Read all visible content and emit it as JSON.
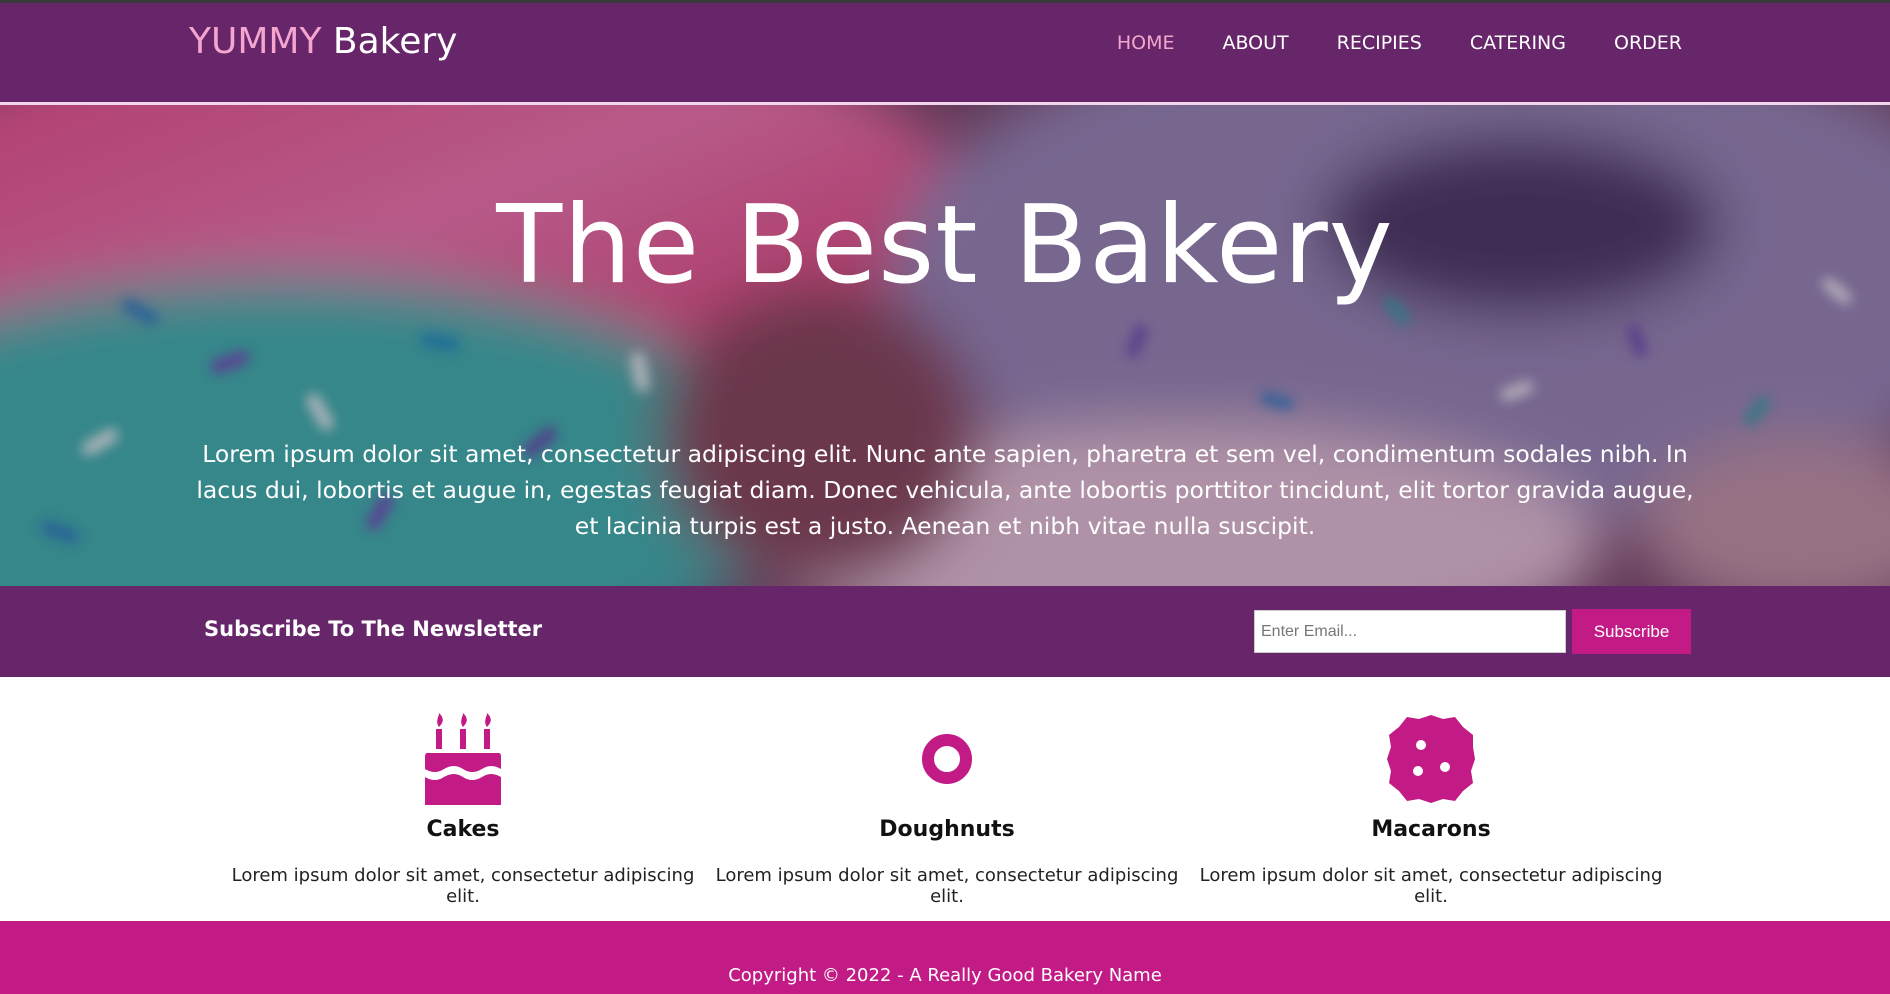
{
  "brand": {
    "accent": "YUMMY",
    "name": "Bakery"
  },
  "nav": {
    "items": [
      {
        "label": "HOME",
        "active": true
      },
      {
        "label": "ABOUT"
      },
      {
        "label": "RECIPIES"
      },
      {
        "label": "CATERING"
      },
      {
        "label": "ORDER"
      }
    ]
  },
  "hero": {
    "title": "The Best Bakery",
    "text": "Lorem ipsum dolor sit amet, consectetur adipiscing elit. Nunc ante sapien, pharetra et sem vel, condimentum sodales nibh. In lacus dui, lobortis et augue in, egestas feugiat diam. Donec vehicula, ante lobortis porttitor tincidunt, elit tortor gravida augue, et lacinia turpis est a justo. Aenean et nibh vitae nulla suscipit."
  },
  "newsletter": {
    "label": "Subscribe To The Newsletter",
    "email_placeholder": "Enter Email...",
    "email_value": "",
    "button_label": "Subscribe"
  },
  "features": [
    {
      "icon": "birthday-cake-icon",
      "title": "Cakes",
      "text": "Lorem ipsum dolor sit amet, consectetur adipiscing elit."
    },
    {
      "icon": "doughnut-icon",
      "title": "Doughnuts",
      "text": "Lorem ipsum dolor sit amet, consectetur adipiscing elit."
    },
    {
      "icon": "cookie-icon",
      "title": "Macarons",
      "text": "Lorem ipsum dolor sit amet, consectetur adipiscing elit."
    }
  ],
  "footer": {
    "copyright": "Copyright © 2022 - A Really Good Bakery Name"
  },
  "colors": {
    "primary": "#67256a",
    "accent": "#c31b86",
    "pink": "#f5a6cf"
  }
}
